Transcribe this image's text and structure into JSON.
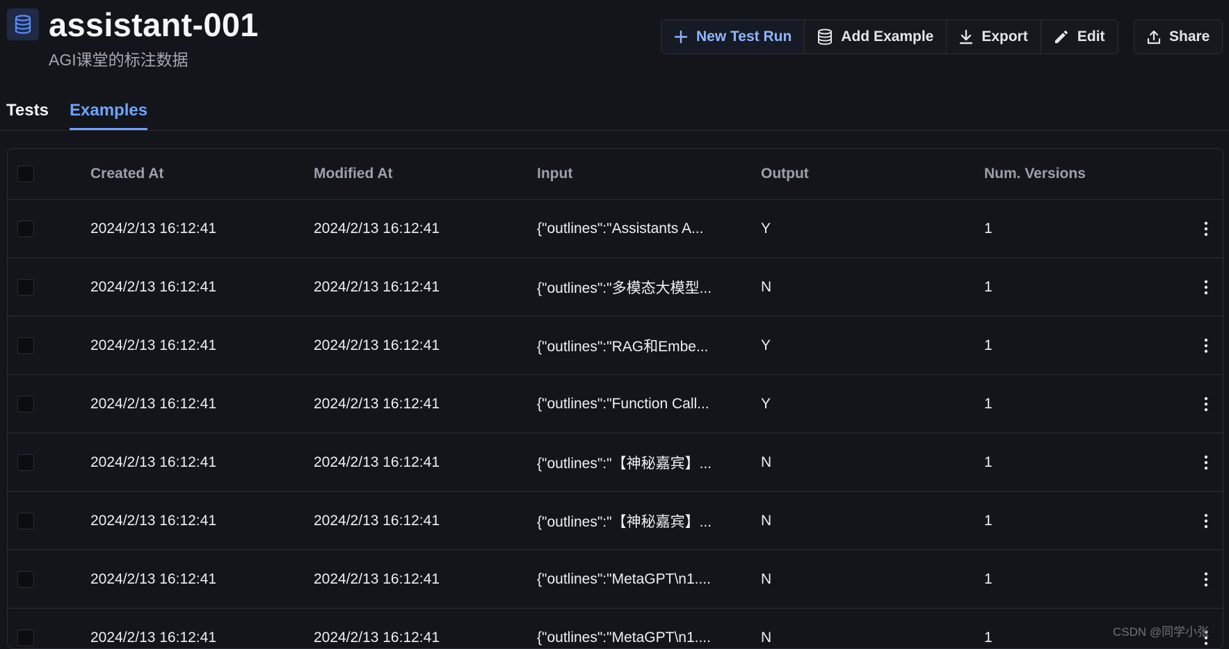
{
  "header": {
    "title": "assistant-001",
    "subtitle": "AGI课堂的标注数据",
    "icon": "database-icon"
  },
  "toolbar": {
    "new_test_run": "New Test Run",
    "add_example": "Add Example",
    "export": "Export",
    "edit": "Edit",
    "share": "Share"
  },
  "tabs": [
    {
      "label": "Tests",
      "active": false
    },
    {
      "label": "Examples",
      "active": true
    }
  ],
  "table": {
    "columns": [
      "Created At",
      "Modified At",
      "Input",
      "Output",
      "Num. Versions"
    ],
    "rows": [
      {
        "created": "2024/2/13 16:12:41",
        "modified": "2024/2/13 16:12:41",
        "input": "{\"outlines\":\"Assistants A...",
        "output": "Y",
        "versions": "1"
      },
      {
        "created": "2024/2/13 16:12:41",
        "modified": "2024/2/13 16:12:41",
        "input": "{\"outlines\":\"多模态大模型...",
        "output": "N",
        "versions": "1"
      },
      {
        "created": "2024/2/13 16:12:41",
        "modified": "2024/2/13 16:12:41",
        "input": "{\"outlines\":\"RAG和Embe...",
        "output": "Y",
        "versions": "1"
      },
      {
        "created": "2024/2/13 16:12:41",
        "modified": "2024/2/13 16:12:41",
        "input": "{\"outlines\":\"Function Call...",
        "output": "Y",
        "versions": "1"
      },
      {
        "created": "2024/2/13 16:12:41",
        "modified": "2024/2/13 16:12:41",
        "input": "{\"outlines\":\"【神秘嘉宾】...",
        "output": "N",
        "versions": "1"
      },
      {
        "created": "2024/2/13 16:12:41",
        "modified": "2024/2/13 16:12:41",
        "input": "{\"outlines\":\"【神秘嘉宾】...",
        "output": "N",
        "versions": "1"
      },
      {
        "created": "2024/2/13 16:12:41",
        "modified": "2024/2/13 16:12:41",
        "input": "{\"outlines\":\"MetaGPT\\n1....",
        "output": "N",
        "versions": "1"
      },
      {
        "created": "2024/2/13 16:12:41",
        "modified": "2024/2/13 16:12:41",
        "input": "{\"outlines\":\"MetaGPT\\n1....",
        "output": "N",
        "versions": "1"
      }
    ]
  },
  "watermark": "CSDN @同学小张",
  "colors": {
    "background": "#14151a",
    "accent": "#6ea3ff",
    "border": "#2a2d34"
  }
}
